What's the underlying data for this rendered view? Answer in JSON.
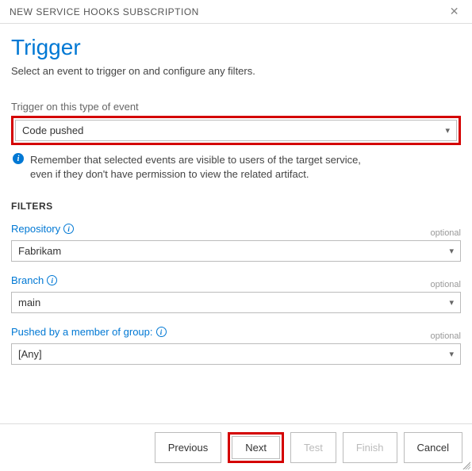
{
  "window": {
    "title": "NEW SERVICE HOOKS SUBSCRIPTION"
  },
  "header": {
    "title": "Trigger",
    "subtitle": "Select an event to trigger on and configure any filters."
  },
  "eventField": {
    "label": "Trigger on this type of event",
    "value": "Code pushed"
  },
  "infoNote": "Remember that selected events are visible to users of the target service, even if they don't have permission to view the related artifact.",
  "filters": {
    "header": "FILTERS",
    "optional_label": "optional",
    "items": [
      {
        "label": "Repository",
        "value": "Fabrikam"
      },
      {
        "label": "Branch",
        "value": "main"
      },
      {
        "label": "Pushed by a member of group:",
        "value": "[Any]"
      }
    ]
  },
  "buttons": {
    "previous": "Previous",
    "next": "Next",
    "test": "Test",
    "finish": "Finish",
    "cancel": "Cancel"
  }
}
